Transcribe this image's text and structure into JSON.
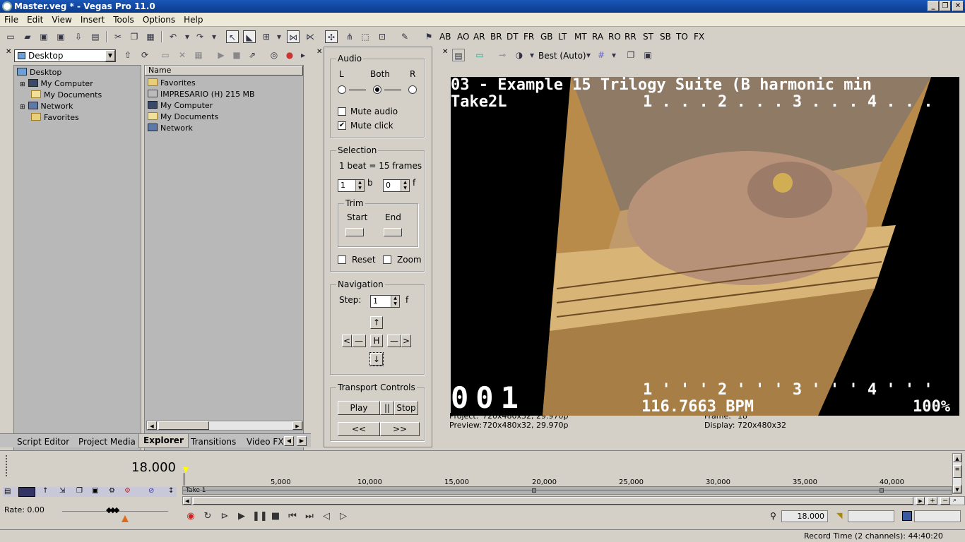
{
  "window": {
    "title": "Master.veg * - Vegas Pro 11.0",
    "min": "_",
    "max": "❐",
    "close": "✕"
  },
  "menu": [
    "File",
    "Edit",
    "View",
    "Insert",
    "Tools",
    "Options",
    "Help"
  ],
  "toolbar": {
    "labels": [
      "AB",
      "AO",
      "AR",
      "BR",
      "DT",
      "FR",
      "GB",
      "LT",
      "MT",
      "RA",
      "RO",
      "RR",
      "ST",
      "SB",
      "TO",
      "FX"
    ]
  },
  "explorer": {
    "location": "Desktop",
    "tree": [
      "Desktop",
      "My Computer",
      "My Documents",
      "Network",
      "Favorites"
    ],
    "list_header": "Name",
    "list": [
      "Favorites",
      "IMPRESARIO (H) 215 MB",
      "My Computer",
      "My Documents",
      "Network"
    ]
  },
  "tabs": [
    "Script Editor",
    "Project Media",
    "Explorer",
    "Transitions",
    "Video FX"
  ],
  "active_tab": "Explorer",
  "metronome": {
    "audio": {
      "title": "Audio",
      "l": "L",
      "both": "Both",
      "r": "R",
      "mute_audio": "Mute audio",
      "mute_click": "Mute click",
      "mute_audio_checked": false,
      "mute_click_checked": true
    },
    "selection": {
      "title": "Selection",
      "beat_info": "1 beat = 15 frames",
      "beats": "1",
      "b_unit": "b",
      "frames": "0",
      "f_unit": "f",
      "trim": "Trim",
      "start": "Start",
      "end": "End",
      "reset": "Reset",
      "zoom": "Zoom"
    },
    "navigation": {
      "title": "Navigation",
      "step_label": "Step:",
      "step": "1",
      "f_unit": "f",
      "up": "↑",
      "left": "<",
      "h": "H",
      "right": ">",
      "down": "↓"
    },
    "transport": {
      "title": "Transport Controls",
      "play": "Play",
      "pause": "||",
      "stop": "Stop",
      "rew": "<<",
      "ffw": ">>"
    }
  },
  "preview": {
    "quality": "Best (Auto)",
    "overlay_line1": "03 - Example 15 Trilogy Suite (B harmonic min",
    "overlay_line2": "Take2L",
    "beat_markers_top": "1 . . . 2 . . . 3 . . . 4 . . .",
    "beat_markers_bottom": "1 ' ' ' 2 ' ' ' 3 ' ' ' 4 ' ' '",
    "counter": "001",
    "bpm": "116.7663 BPM",
    "percent": "100%",
    "project_label": "Project:",
    "project": "720x480x32, 29.970p",
    "preview_label": "Preview:",
    "preview": "720x480x32, 29.970p",
    "frame_label": "Frame:",
    "frame": "18",
    "display_label": "Display:",
    "display": "720x480x32"
  },
  "timeline": {
    "time": "18.000",
    "ticks": [
      "5,000",
      "10,000",
      "15,000",
      "20,000",
      "25,000",
      "30,000",
      "35,000",
      "40,000"
    ],
    "region": "Take 1",
    "rate": "Rate: 0.00",
    "position": "18.000",
    "record_time": "Record Time (2 channels): 44:40:20"
  }
}
